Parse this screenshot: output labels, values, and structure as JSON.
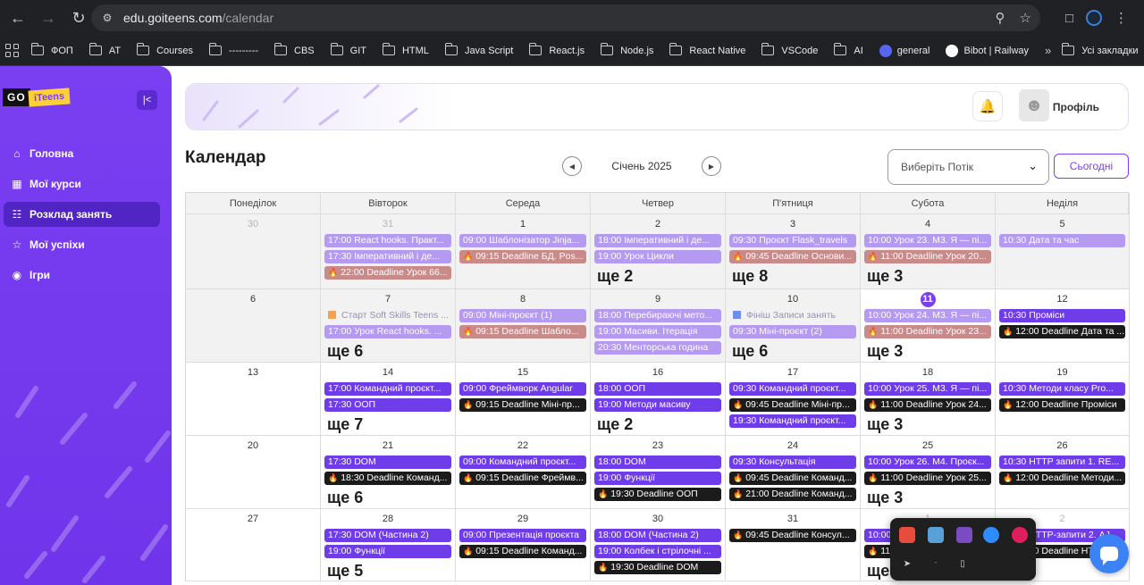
{
  "browser": {
    "url_host": "edu.goiteens.com",
    "url_path": "/calendar",
    "bookmarks": [
      {
        "label": "ФОП",
        "kind": "folder"
      },
      {
        "label": "AT",
        "kind": "folder"
      },
      {
        "label": "Courses",
        "kind": "folder"
      },
      {
        "label": "---------",
        "kind": "folder"
      },
      {
        "label": "CBS",
        "kind": "folder"
      },
      {
        "label": "GIT",
        "kind": "folder"
      },
      {
        "label": "HTML",
        "kind": "folder"
      },
      {
        "label": "Java Script",
        "kind": "folder"
      },
      {
        "label": "React.js",
        "kind": "folder"
      },
      {
        "label": "Node.js",
        "kind": "folder"
      },
      {
        "label": "React Native",
        "kind": "folder"
      },
      {
        "label": "VSCode",
        "kind": "folder"
      },
      {
        "label": "AI",
        "kind": "folder"
      },
      {
        "label": "general",
        "kind": "discord"
      },
      {
        "label": "Bibot | Railway",
        "kind": "railway"
      }
    ],
    "bookmarks_more": "»",
    "all_bookmarks": "Усі закладки"
  },
  "sidebar": {
    "logo_go": "GO",
    "logo_teens": "iTeens",
    "items": [
      {
        "label": "Головна",
        "icon": "home-icon",
        "active": false
      },
      {
        "label": "Мої курси",
        "icon": "courses-icon",
        "active": false
      },
      {
        "label": "Розклад занять",
        "icon": "calendar-icon",
        "active": true
      },
      {
        "label": "Мої успіхи",
        "icon": "trophy-icon",
        "active": false
      },
      {
        "label": "Ігри",
        "icon": "gamepad-icon",
        "active": false
      }
    ]
  },
  "header": {
    "profile_label": "Профіль"
  },
  "calendar": {
    "title": "Календар",
    "month_label": "Січень 2025",
    "stream_placeholder": "Виберіть Потік",
    "today_button": "Сьогодні",
    "weekdays": [
      "Понеділок",
      "Вівторок",
      "Середа",
      "Четвер",
      "П'ятниця",
      "Субота",
      "Неділя"
    ],
    "weeks": [
      [
        {
          "day": "30",
          "other": true,
          "events": []
        },
        {
          "day": "31",
          "other": true,
          "events": [
            {
              "text": "17:00 React hooks. Практ...",
              "c": "pl"
            },
            {
              "text": "17:30 Імперативний і де...",
              "c": "pl"
            },
            {
              "text": "22:00 Deadline Урок 66...",
              "c": "rd",
              "fire": true
            }
          ]
        },
        {
          "day": "1",
          "events": [
            {
              "text": "09:00 Шаблонізатор Jinja...",
              "c": "pl"
            },
            {
              "text": "09:15 Deadline БД. Pos...",
              "c": "rd",
              "fire": true
            }
          ]
        },
        {
          "day": "2",
          "events": [
            {
              "text": "18:00 Імперативний і де...",
              "c": "pl"
            },
            {
              "text": "19:00 Урок Цикли",
              "c": "pl"
            }
          ],
          "more": "ще 2"
        },
        {
          "day": "3",
          "events": [
            {
              "text": "09:30 Проєкт Flask_travels",
              "c": "pl"
            },
            {
              "text": "09:45 Deadline Основи...",
              "c": "rd",
              "fire": true
            }
          ],
          "more": "ще 8"
        },
        {
          "day": "4",
          "events": [
            {
              "text": "10:00 Урок 23. M3. Я — пі...",
              "c": "pl"
            },
            {
              "text": "11:00 Deadline Урок 20...",
              "c": "rd",
              "fire": true
            }
          ],
          "more": "ще 3"
        },
        {
          "day": "5",
          "events": [
            {
              "text": "10:30 Дата та час",
              "c": "pl"
            }
          ]
        }
      ],
      [
        {
          "day": "6",
          "events": []
        },
        {
          "day": "7",
          "events": [
            {
              "text": "Старт Soft Skills Teens ...",
              "c": "mark",
              "flag": "o"
            },
            {
              "text": "17:00 Урок React hooks. ...",
              "c": "pl"
            }
          ],
          "more": "ще 6"
        },
        {
          "day": "8",
          "events": [
            {
              "text": "09:00 Міні-проєкт (1)",
              "c": "pl"
            },
            {
              "text": "09:15 Deadline Шабло...",
              "c": "rd",
              "fire": true
            }
          ]
        },
        {
          "day": "9",
          "events": [
            {
              "text": "18:00 Перебираючі мето...",
              "c": "pl"
            },
            {
              "text": "19:00 Масиви. Ітерація",
              "c": "pl"
            },
            {
              "text": "20:30 Менторська година",
              "c": "pl"
            }
          ]
        },
        {
          "day": "10",
          "events": [
            {
              "text": "Фініш Записи занять",
              "c": "mark",
              "flag": "b"
            },
            {
              "text": "09:30 Міні-проєкт (2)",
              "c": "pl"
            }
          ],
          "more": "ще 6"
        },
        {
          "day": "11",
          "today": true,
          "current": true,
          "events": [
            {
              "text": "10:00 Урок 24. M3. Я — пі...",
              "c": "pl"
            },
            {
              "text": "11:00 Deadline Урок 23...",
              "c": "rd",
              "fire": true
            }
          ],
          "more": "ще 3"
        },
        {
          "day": "12",
          "current": true,
          "events": [
            {
              "text": "10:30 Проміси",
              "c": "p"
            },
            {
              "text": "12:00 Deadline Дата та ...",
              "c": "bk",
              "fire": true
            }
          ]
        }
      ],
      [
        {
          "day": "13",
          "current": true,
          "events": []
        },
        {
          "day": "14",
          "current": true,
          "events": [
            {
              "text": "17:00 Командний проєкт...",
              "c": "p"
            },
            {
              "text": "17:30 ООП",
              "c": "p"
            }
          ],
          "more": "ще 7"
        },
        {
          "day": "15",
          "current": true,
          "events": [
            {
              "text": "09:00 Фреймворк Angular",
              "c": "p"
            },
            {
              "text": "09:15 Deadline Міні-пр...",
              "c": "bk",
              "fire": true
            }
          ]
        },
        {
          "day": "16",
          "current": true,
          "events": [
            {
              "text": "18:00 ООП",
              "c": "p"
            },
            {
              "text": "19:00 Методи масиву",
              "c": "p"
            }
          ],
          "more": "ще 2"
        },
        {
          "day": "17",
          "current": true,
          "events": [
            {
              "text": "09:30 Командний проєкт...",
              "c": "p"
            },
            {
              "text": "09:45 Deadline Міні-пр...",
              "c": "bk",
              "fire": true
            },
            {
              "text": "19:30 Командний проєкт...",
              "c": "p"
            }
          ]
        },
        {
          "day": "18",
          "current": true,
          "events": [
            {
              "text": "10:00 Урок 25. M3. Я — пі...",
              "c": "p"
            },
            {
              "text": "11:00 Deadline Урок 24...",
              "c": "bk",
              "fire": true
            }
          ],
          "more": "ще 3"
        },
        {
          "day": "19",
          "current": true,
          "events": [
            {
              "text": "10:30 Методи класу Pro...",
              "c": "p"
            },
            {
              "text": "12:00 Deadline Проміси",
              "c": "bk",
              "fire": true
            }
          ]
        }
      ],
      [
        {
          "day": "20",
          "current": true,
          "events": []
        },
        {
          "day": "21",
          "current": true,
          "events": [
            {
              "text": "17:30 DOM",
              "c": "p"
            },
            {
              "text": "18:30 Deadline Команд...",
              "c": "bk",
              "fire": true
            }
          ],
          "more": "ще 6"
        },
        {
          "day": "22",
          "current": true,
          "events": [
            {
              "text": "09:00 Командний проєкт...",
              "c": "p"
            },
            {
              "text": "09:15 Deadline Фреймв...",
              "c": "bk",
              "fire": true
            }
          ]
        },
        {
          "day": "23",
          "current": true,
          "events": [
            {
              "text": "18:00 DOM",
              "c": "p"
            },
            {
              "text": "19:00 Функції",
              "c": "p"
            },
            {
              "text": "19:30 Deadline ООП",
              "c": "bk",
              "fire": true
            }
          ]
        },
        {
          "day": "24",
          "current": true,
          "events": [
            {
              "text": "09:30 Консультація",
              "c": "p"
            },
            {
              "text": "09:45 Deadline Команд...",
              "c": "bk",
              "fire": true
            },
            {
              "text": "21:00 Deadline Команд...",
              "c": "bk",
              "fire": true
            }
          ]
        },
        {
          "day": "25",
          "current": true,
          "events": [
            {
              "text": "10:00 Урок 26. M4. Проєк...",
              "c": "p"
            },
            {
              "text": "11:00 Deadline Урок 25...",
              "c": "bk",
              "fire": true
            }
          ],
          "more": "ще 3"
        },
        {
          "day": "26",
          "current": true,
          "events": [
            {
              "text": "10:30 HTTP запити 1. RE...",
              "c": "p"
            },
            {
              "text": "12:00 Deadline Методи...",
              "c": "bk",
              "fire": true
            }
          ]
        }
      ],
      [
        {
          "day": "27",
          "current": true,
          "events": []
        },
        {
          "day": "28",
          "current": true,
          "events": [
            {
              "text": "17:30 DOM (Частина 2)",
              "c": "p"
            },
            {
              "text": "19:00 Функції",
              "c": "p"
            }
          ],
          "more": "ще 5"
        },
        {
          "day": "29",
          "current": true,
          "events": [
            {
              "text": "09:00 Презентація проєкта",
              "c": "p"
            },
            {
              "text": "09:15 Deadline Команд...",
              "c": "bk",
              "fire": true
            }
          ]
        },
        {
          "day": "30",
          "current": true,
          "events": [
            {
              "text": "18:00 DOM (Частина 2)",
              "c": "p"
            },
            {
              "text": "19:00 Колбек і стрілочні ...",
              "c": "p"
            },
            {
              "text": "19:30 Deadline DOM",
              "c": "bk",
              "fire": true
            }
          ]
        },
        {
          "day": "31",
          "current": true,
          "events": [
            {
              "text": "09:45 Deadline Консул...",
              "c": "bk",
              "fire": true
            }
          ]
        },
        {
          "day": "1",
          "other": true,
          "current": true,
          "events": [
            {
              "text": "10:00 Урок 27...",
              "c": "p"
            },
            {
              "text": "11:00 Deadline...",
              "c": "bk",
              "fire": true
            }
          ],
          "more": "ще 3"
        },
        {
          "day": "2",
          "other": true,
          "current": true,
          "events": [
            {
              "text": "10:30 HTTP-запити 2. AJ...",
              "c": "p"
            },
            {
              "text": "12:00 Deadline HTTP...",
              "c": "bk",
              "fire": true
            }
          ]
        }
      ]
    ]
  }
}
